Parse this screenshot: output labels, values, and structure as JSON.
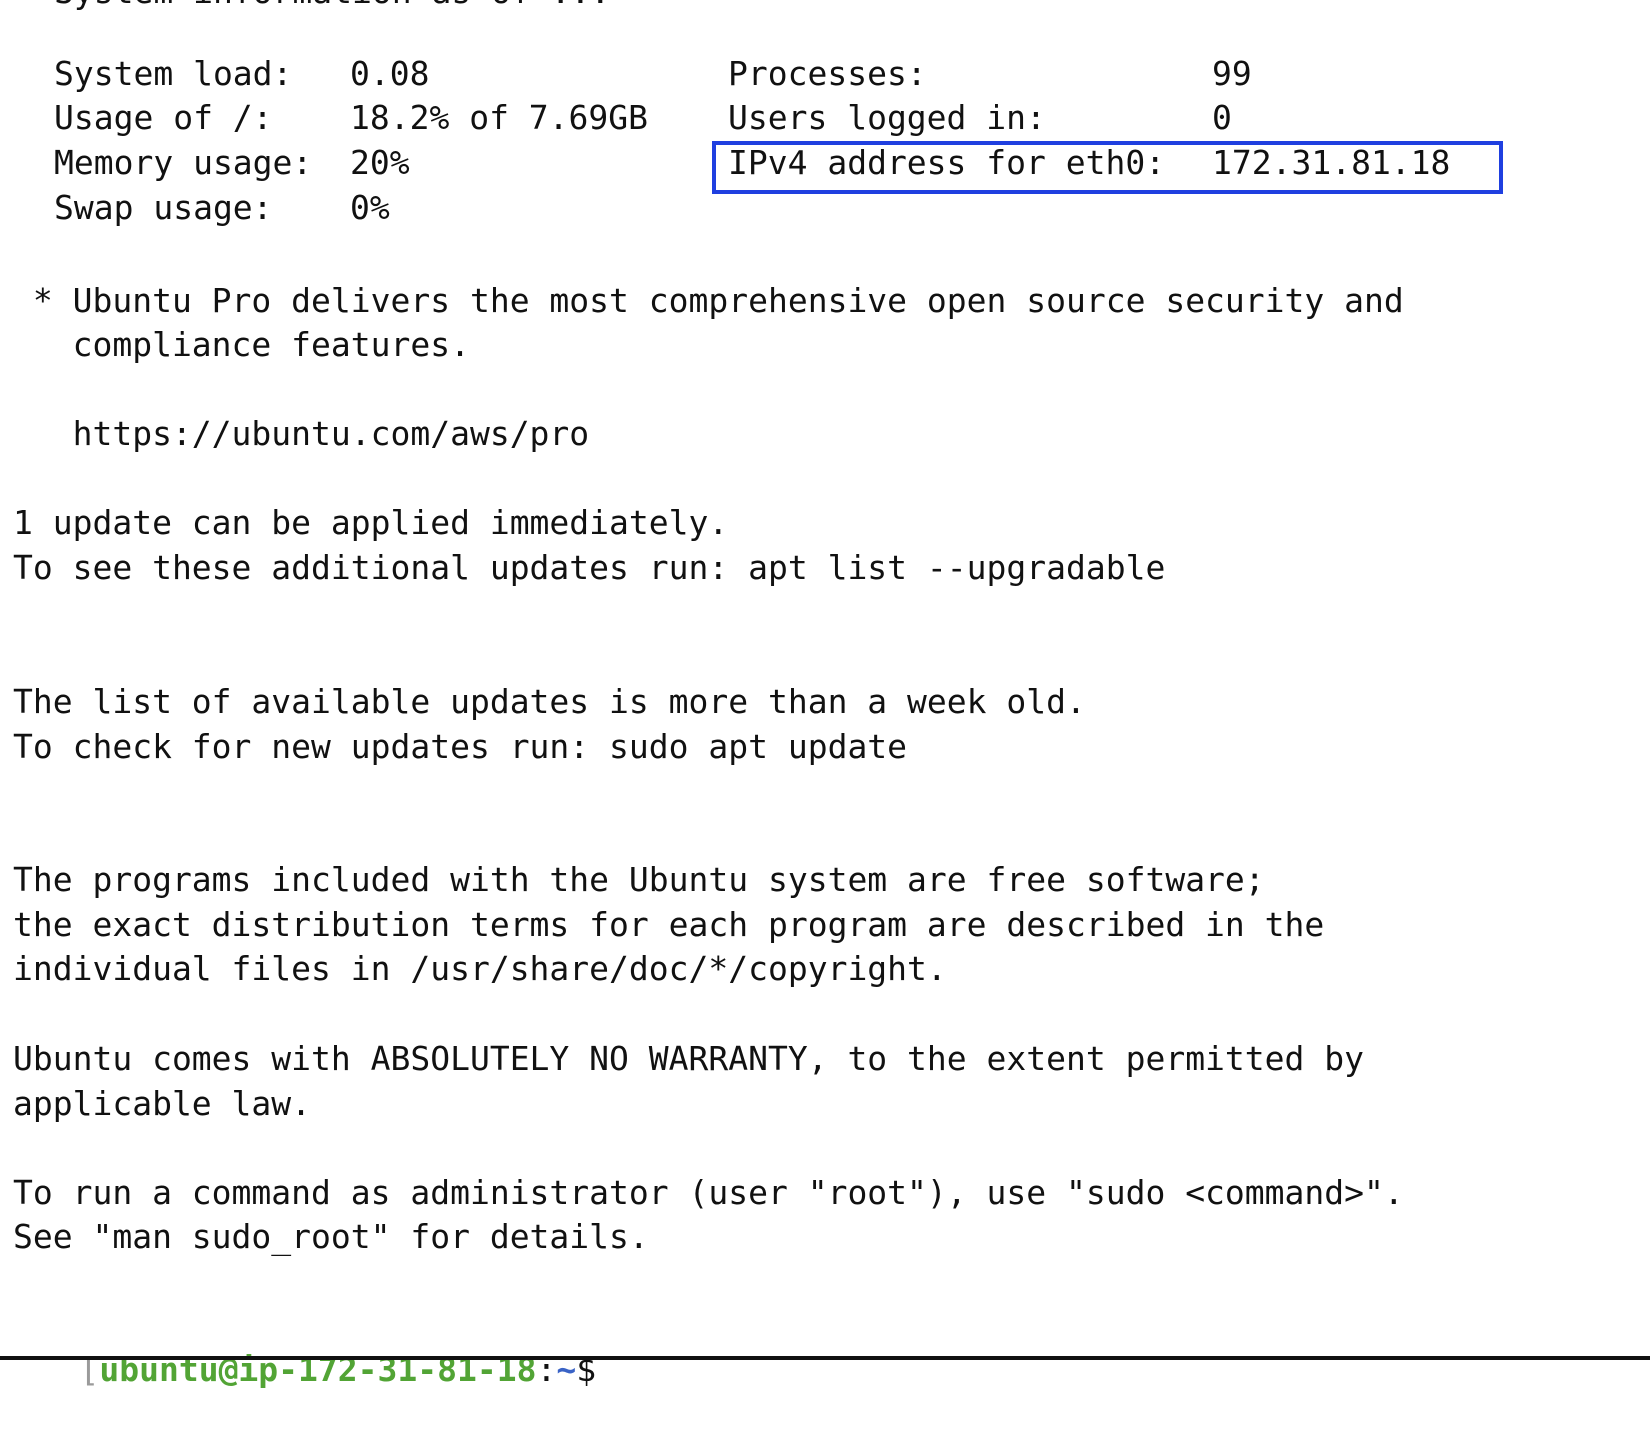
{
  "top_partial_line": "System information as of ...",
  "sysinfo": {
    "system_load_label": "System load:",
    "system_load_value": "0.08",
    "usage_label": "Usage of /:",
    "usage_value": "18.2% of 7.69GB",
    "memory_label": "Memory usage:",
    "memory_value": "20%",
    "swap_label": "Swap usage:",
    "swap_value": "0%",
    "processes_label": "Processes:",
    "processes_value": "99",
    "users_label": "Users logged in:",
    "users_value": "0",
    "ipv4_label": "IPv4 address for eth0:",
    "ipv4_value": "172.31.81.18",
    "highlight_color": "#1f3fe0"
  },
  "pro_notice": {
    "line1": " * Ubuntu Pro delivers the most comprehensive open source security and",
    "line2": "   compliance features.",
    "url": "   https://ubuntu.com/aws/pro"
  },
  "updates": {
    "line1": "1 update can be applied immediately.",
    "line2": "To see these additional updates run: apt list --upgradable"
  },
  "update_age": {
    "line1": "The list of available updates is more than a week old.",
    "line2": "To check for new updates run: sudo apt update"
  },
  "license": {
    "line1": "The programs included with the Ubuntu system are free software;",
    "line2": "the exact distribution terms for each program are described in the",
    "line3": "individual files in /usr/share/doc/*/copyright."
  },
  "warranty": {
    "line1": "Ubuntu comes with ABSOLUTELY NO WARRANTY, to the extent permitted by",
    "line2": "applicable law."
  },
  "sudo_hint": {
    "line1": "To run a command as administrator (user \"root\"), use \"sudo <command>\".",
    "line2": "See \"man sudo_root\" for details."
  },
  "prompt": {
    "bracket": "[",
    "user_host": "ubuntu@ip-172-31-81-18",
    "colon": ":",
    "path": "~",
    "symbol": "$",
    "user_color": "#52a435",
    "path_color": "#3a63c6"
  }
}
